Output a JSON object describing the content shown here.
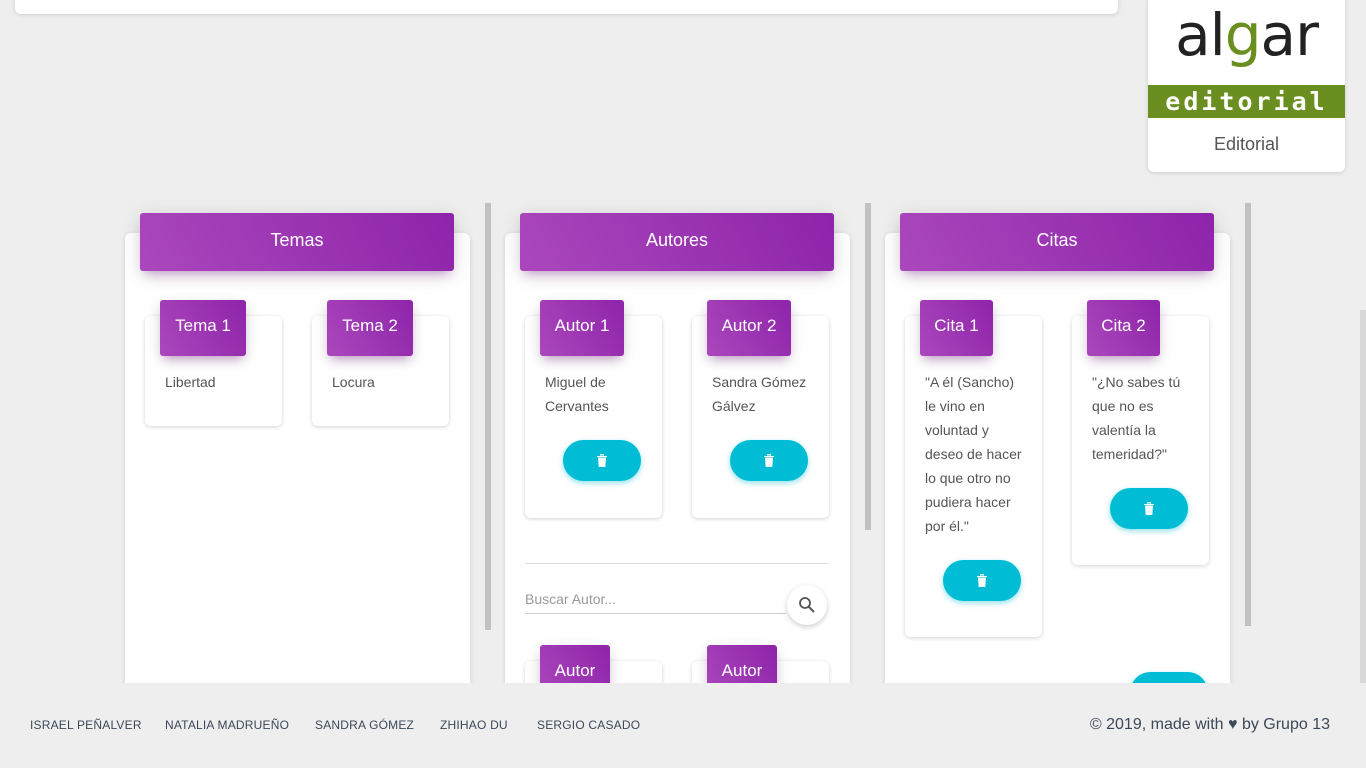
{
  "publisher": {
    "logo_text_parts": [
      "al",
      "g",
      "ar"
    ],
    "logo_band_text": "editorial",
    "label": "Editorial"
  },
  "columns": [
    {
      "title": "Temas",
      "cards": [
        {
          "header": "Tema 1",
          "text": "Libertad"
        },
        {
          "header": "Tema 2",
          "text": "Locura"
        }
      ]
    },
    {
      "title": "Autores",
      "cards": [
        {
          "header": "Autor 1",
          "text": "Miguel de Cervantes"
        },
        {
          "header": "Autor 2",
          "text": "Sandra Gómez Gálvez"
        }
      ],
      "search_placeholder": "Buscar Autor...",
      "extra_cards": [
        {
          "header": "Autor"
        },
        {
          "header": "Autor"
        }
      ]
    },
    {
      "title": "Citas",
      "cards": [
        {
          "header": "Cita 1",
          "text": "\"A él (Sancho) le vino en voluntad y deseo de hacer lo que otro no pudiera hacer por él.\""
        },
        {
          "header": "Cita 2",
          "text": "\"¿No sabes tú que no es valentía la temeridad?\""
        }
      ]
    }
  ],
  "footer": {
    "links": [
      "ISRAEL PEÑALVER",
      "NATALIA MADRUEÑO",
      "SANDRA GÓMEZ",
      "ZHIHAO DU",
      "SERGIO CASADO"
    ],
    "copyright_prefix": "© 2019, made with",
    "copyright_suffix": "by Grupo 13"
  },
  "icons": {
    "delete": "trash-icon",
    "search": "search-icon",
    "heart": "heart-icon"
  },
  "colors": {
    "header_gradient_start": "#ab47bc",
    "header_gradient_end": "#8e24aa",
    "button": "#00bcd4",
    "logo_green": "#6a8e1f"
  }
}
